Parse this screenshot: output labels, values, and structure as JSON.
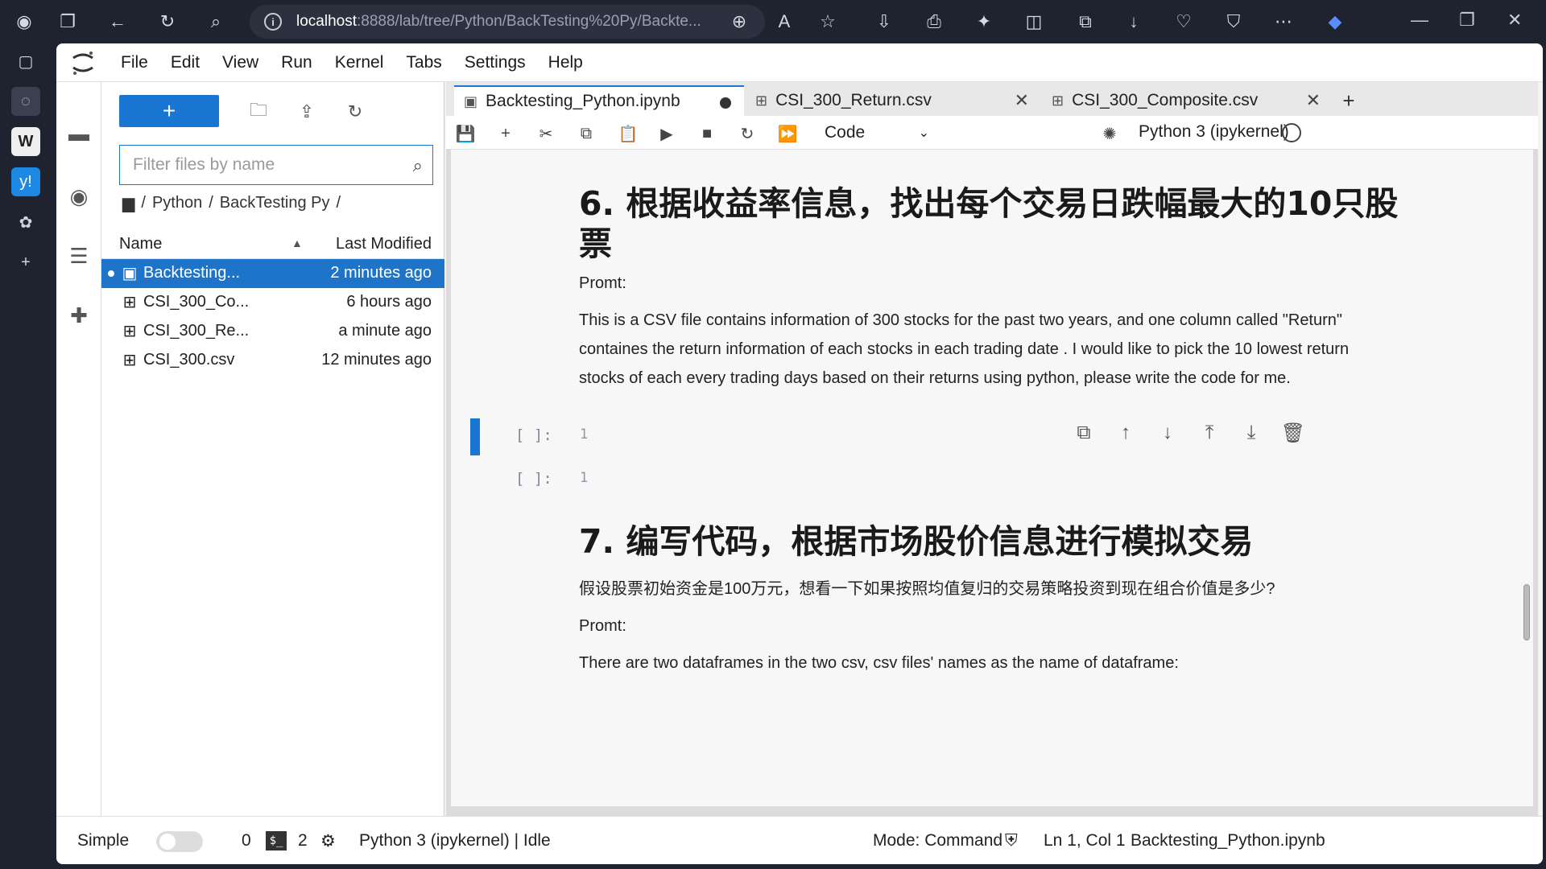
{
  "browser": {
    "url_host": "localhost",
    "url_rest": ":8888/lab/tree/Python/BackTesting%20Py/Backte..."
  },
  "menu": [
    "File",
    "Edit",
    "View",
    "Run",
    "Kernel",
    "Tabs",
    "Settings",
    "Help"
  ],
  "filebrowser": {
    "new_label": "+",
    "filter_placeholder": "Filter files by name",
    "breadcrumb": [
      "Python",
      "BackTesting Py"
    ],
    "col_name": "Name",
    "col_modified": "Last Modified",
    "files": [
      {
        "name": "Backtesting...",
        "modified": "2 minutes ago",
        "icon": "notebook-icon",
        "selected": true
      },
      {
        "name": "CSI_300_Co...",
        "modified": "6 hours ago",
        "icon": "table-icon",
        "selected": false
      },
      {
        "name": "CSI_300_Re...",
        "modified": "a minute ago",
        "icon": "table-icon",
        "selected": false
      },
      {
        "name": "CSI_300.csv",
        "modified": "12 minutes ago",
        "icon": "table-icon",
        "selected": false
      }
    ]
  },
  "tabs": [
    {
      "label": "Backtesting_Python.ipynb",
      "icon": "notebook-icon",
      "active": true,
      "modified": true
    },
    {
      "label": "CSI_300_Return.csv",
      "icon": "table-icon",
      "active": false
    },
    {
      "label": "CSI_300_Composite.csv",
      "icon": "table-icon",
      "active": false
    }
  ],
  "toolbar": {
    "cell_type": "Code",
    "kernel": "Python 3 (ipykernel)"
  },
  "notebook": {
    "section6_heading": "6. 根据收益率信息，找出每个交易日跌幅最大的10只股票",
    "promt1_label": "Promt:",
    "promt1_text": "This is a CSV file contains information of 300 stocks for the past two years, and one column called \"Return\" containes the return information of each stocks in each trading date . I would like to pick the 10 lowest return stocks of each every trading days based on their returns using python, please write the code for me.",
    "cell1_prompt": "[ ]:",
    "cell1_lineno": "1",
    "cell2_prompt": "[ ]:",
    "cell2_lineno": "1",
    "section7_heading": "7. 编写代码，根据市场股价信息进行模拟交易",
    "section7_text": "假设股票初始资金是100万元，想看一下如果按照均值复归的交易策略投资到现在组合价值是多少?",
    "promt2_label": "Promt:",
    "promt2_text": "There are two dataframes in the two csv, csv files' names as the name of dataframe:"
  },
  "statusbar": {
    "simple": "Simple",
    "count1": "0",
    "count2": "2",
    "kernel_state": "Python 3 (ipykernel) | Idle",
    "mode": "Mode: Command",
    "position": "Ln 1, Col 1",
    "filename": "Backtesting_Python.ipynb"
  },
  "colors": {
    "accent": "#1976d2",
    "selected_row": "#1e74c9"
  }
}
